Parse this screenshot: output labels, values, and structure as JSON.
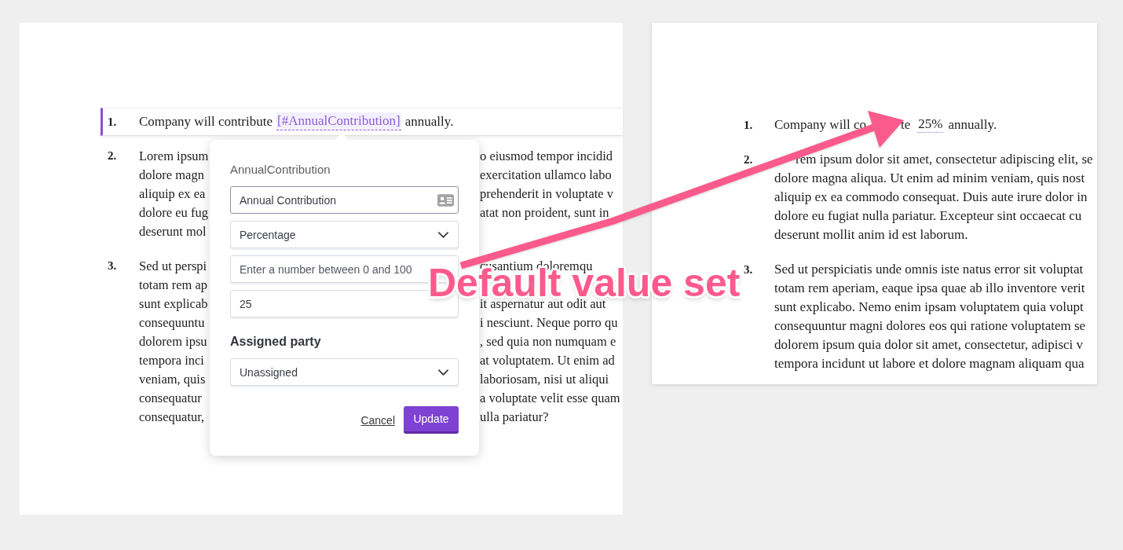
{
  "left_document": {
    "items": [
      {
        "kind": "clause",
        "number": "1.",
        "selected": true,
        "text": "Company will contribute",
        "field": "[#AnnualContribution]",
        "text_end": "annually."
      },
      {
        "kind": "paragraph",
        "number": "2.",
        "selected": false,
        "lines": [
          {
            "left": "Lorem ipsum",
            "right": "o eiusmod tempor incidid"
          },
          {
            "left": "dolore magn",
            "right": "exercitation ullamco labo"
          },
          {
            "left": "aliquip ex ea",
            "right": "prehenderit in voluptate v"
          },
          {
            "left": "dolore eu fug",
            "right": "atat non proident, sunt in"
          },
          {
            "left": "deserunt mol"
          }
        ]
      },
      {
        "kind": "paragraph",
        "number": "3.",
        "selected": false,
        "lines": [
          {
            "left": "Sed ut perspi",
            "right": "cusantium doloremqu"
          },
          {
            "left": "totam rem ap"
          },
          {
            "left": "sunt explicab",
            "right": "it aspernatur aut odit aut"
          },
          {
            "left": "consequuntu",
            "right": "i nesciunt. Neque porro qu"
          },
          {
            "left": "dolorem ipsu",
            "right": ", sed quia non numquam e"
          },
          {
            "left": "tempora inci",
            "right": "at voluptatem. Ut enim ad"
          },
          {
            "left": "veniam, quis",
            "right": "laboriosam, nisi ut aliqui"
          },
          {
            "left": "consequatur",
            "right": "a voluptate velit esse quam"
          },
          {
            "left": "consequatur,",
            "right": "ulla pariatur?"
          }
        ]
      }
    ]
  },
  "popover": {
    "title": "AnnualContribution",
    "fields": [
      {
        "kind": "tagged",
        "value": "Annual Contribution",
        "focused": true
      },
      {
        "kind": "select",
        "value": "Percentage",
        "focused": false
      },
      {
        "kind": "plain",
        "placeholder": "Enter a number between 0 and 100",
        "focused": false
      },
      {
        "kind": "plain",
        "value": "25",
        "focused": false
      }
    ],
    "party_label": "Assigned party",
    "party_field": {
      "kind": "select",
      "value": "Unassigned",
      "focused": false
    },
    "cancel": "Cancel",
    "submit": "Update"
  },
  "right_document": {
    "items": [
      {
        "kind": "clause",
        "number": "1.",
        "text": "Company will co",
        "text_mid": "te",
        "value": "25%",
        "text_end": "annually."
      },
      {
        "kind": "covered",
        "number": "2.",
        "lines": [
          "rem ipsum dolor sit amet, consectetur adipiscing elit, se",
          "dolore magna aliqua. Ut enim ad minim veniam, quis nost",
          "aliquip ex ea commodo consequat. Duis aute irure dolor in",
          "dolore eu fugiat nulla pariatur. Excepteur sint occaecat cu",
          "deserunt mollit anim id est laborum."
        ]
      },
      {
        "kind": "paragraph",
        "number": "3.",
        "lines": [
          "Sed ut perspiciatis unde omnis iste natus error sit voluptat",
          "totam rem aperiam, eaque ipsa quae ab illo inventore verit",
          "sunt explicabo. Nemo enim ipsam voluptatem quia volupt",
          "consequuntur magni dolores eos qui ratione voluptatem se",
          "dolorem ipsum quia dolor sit amet, consectetur, adipisci v",
          "tempora incidunt ut labore et dolore magnam aliquam qua"
        ]
      }
    ]
  },
  "annotation": {
    "label": "Default value set"
  }
}
